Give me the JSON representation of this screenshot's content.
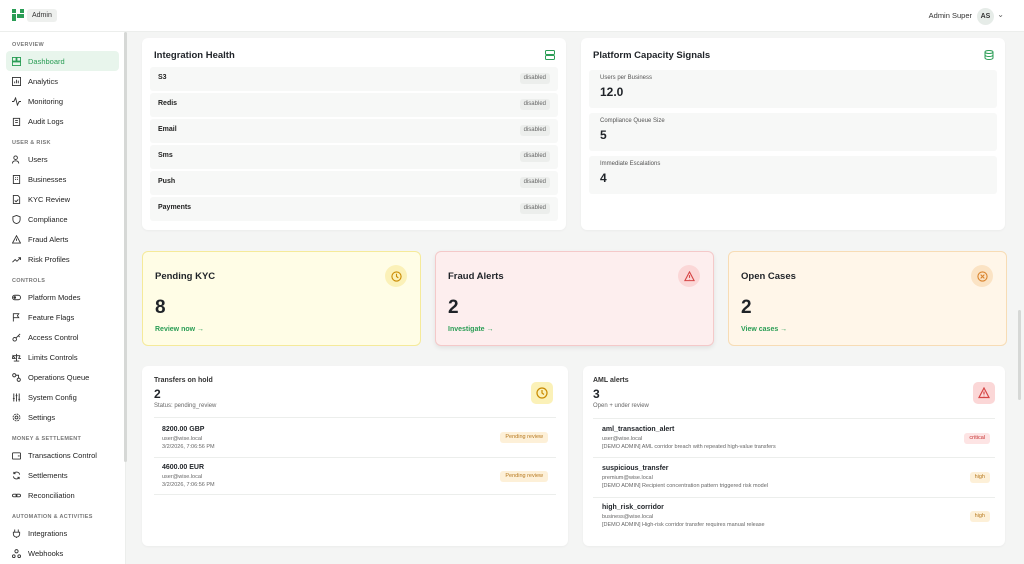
{
  "header": {
    "app_badge": "Admin",
    "user_name": "Admin Super",
    "avatar_initials": "AS",
    "brand_color": "#2a9d55"
  },
  "sidebar": {
    "sections": [
      {
        "title": "OVERVIEW",
        "items": [
          {
            "label": "Dashboard",
            "icon": "dashboard-icon",
            "active": true
          },
          {
            "label": "Analytics",
            "icon": "bar-chart-icon"
          },
          {
            "label": "Monitoring",
            "icon": "activity-icon"
          },
          {
            "label": "Audit Logs",
            "icon": "clipboard-icon"
          }
        ]
      },
      {
        "title": "USER & RISK",
        "items": [
          {
            "label": "Users",
            "icon": "users-icon"
          },
          {
            "label": "Businesses",
            "icon": "building-icon"
          },
          {
            "label": "KYC Review",
            "icon": "file-check-icon"
          },
          {
            "label": "Compliance",
            "icon": "shield-icon"
          },
          {
            "label": "Fraud Alerts",
            "icon": "alert-triangle-icon"
          },
          {
            "label": "Risk Profiles",
            "icon": "trending-up-icon"
          }
        ]
      },
      {
        "title": "CONTROLS",
        "items": [
          {
            "label": "Platform Modes",
            "icon": "toggle-icon"
          },
          {
            "label": "Feature Flags",
            "icon": "flag-icon"
          },
          {
            "label": "Access Control",
            "icon": "key-icon"
          },
          {
            "label": "Limits Controls",
            "icon": "scale-icon"
          },
          {
            "label": "Operations Queue",
            "icon": "workflow-icon"
          },
          {
            "label": "System Config",
            "icon": "sliders-icon"
          },
          {
            "label": "Settings",
            "icon": "gear-icon"
          }
        ]
      },
      {
        "title": "MONEY & SETTLEMENT",
        "items": [
          {
            "label": "Transactions Control",
            "icon": "wallet-icon"
          },
          {
            "label": "Settlements",
            "icon": "refresh-icon"
          },
          {
            "label": "Reconciliation",
            "icon": "link-icon"
          }
        ]
      },
      {
        "title": "AUTOMATION & ACTIVITIES",
        "items": [
          {
            "label": "Integrations",
            "icon": "plug-icon"
          },
          {
            "label": "Webhooks",
            "icon": "webhook-icon"
          }
        ]
      }
    ]
  },
  "integration_health": {
    "title": "Integration Health",
    "rows": [
      {
        "name": "S3",
        "status": "disabled"
      },
      {
        "name": "Redis",
        "status": "disabled"
      },
      {
        "name": "Email",
        "status": "disabled"
      },
      {
        "name": "Sms",
        "status": "disabled"
      },
      {
        "name": "Push",
        "status": "disabled"
      },
      {
        "name": "Payments",
        "status": "disabled"
      }
    ]
  },
  "capacity": {
    "title": "Platform Capacity Signals",
    "metrics": [
      {
        "label": "Users per Business",
        "value": "12.0"
      },
      {
        "label": "Compliance Queue Size",
        "value": "5"
      },
      {
        "label": "Immediate Escalations",
        "value": "4"
      }
    ]
  },
  "stats": {
    "kyc": {
      "title": "Pending KYC",
      "count": "8",
      "link": "Review now →",
      "bg": "#fffde6",
      "border": "#f5ea9a"
    },
    "fraud": {
      "title": "Fraud Alerts",
      "count": "2",
      "link": "Investigate →",
      "bg": "#fdeeee",
      "border": "#f4c9c9"
    },
    "cases": {
      "title": "Open Cases",
      "count": "2",
      "link": "View cases →",
      "bg": "#fff6e9",
      "border": "#f7dcb5"
    }
  },
  "transfers": {
    "label": "Transfers on hold",
    "count": "2",
    "subtitle": "Status: pending_review",
    "items": [
      {
        "amount": "8200.00 GBP",
        "email": "user@wise.local",
        "time": "3/2/2026, 7:06:56 PM",
        "tag": "Pending review"
      },
      {
        "amount": "4600.00 EUR",
        "email": "user@wise.local",
        "time": "3/2/2026, 7:06:56 PM",
        "tag": "Pending review"
      }
    ]
  },
  "aml": {
    "label": "AML alerts",
    "count": "3",
    "subtitle": "Open + under review",
    "items": [
      {
        "name": "aml_transaction_alert",
        "email": "user@wise.local",
        "desc": "[DEMO ADMIN] AML corridor breach with repeated high-value transfers",
        "tag": "critical",
        "tone": "red"
      },
      {
        "name": "suspicious_transfer",
        "email": "premium@wise.local",
        "desc": "[DEMO ADMIN] Recipient concentration pattern triggered risk model",
        "tag": "high",
        "tone": "amber"
      },
      {
        "name": "high_risk_corridor",
        "email": "business@wise.local",
        "desc": "[DEMO ADMIN] High-risk corridor transfer requires manual release",
        "tag": "high",
        "tone": "amber"
      }
    ]
  }
}
